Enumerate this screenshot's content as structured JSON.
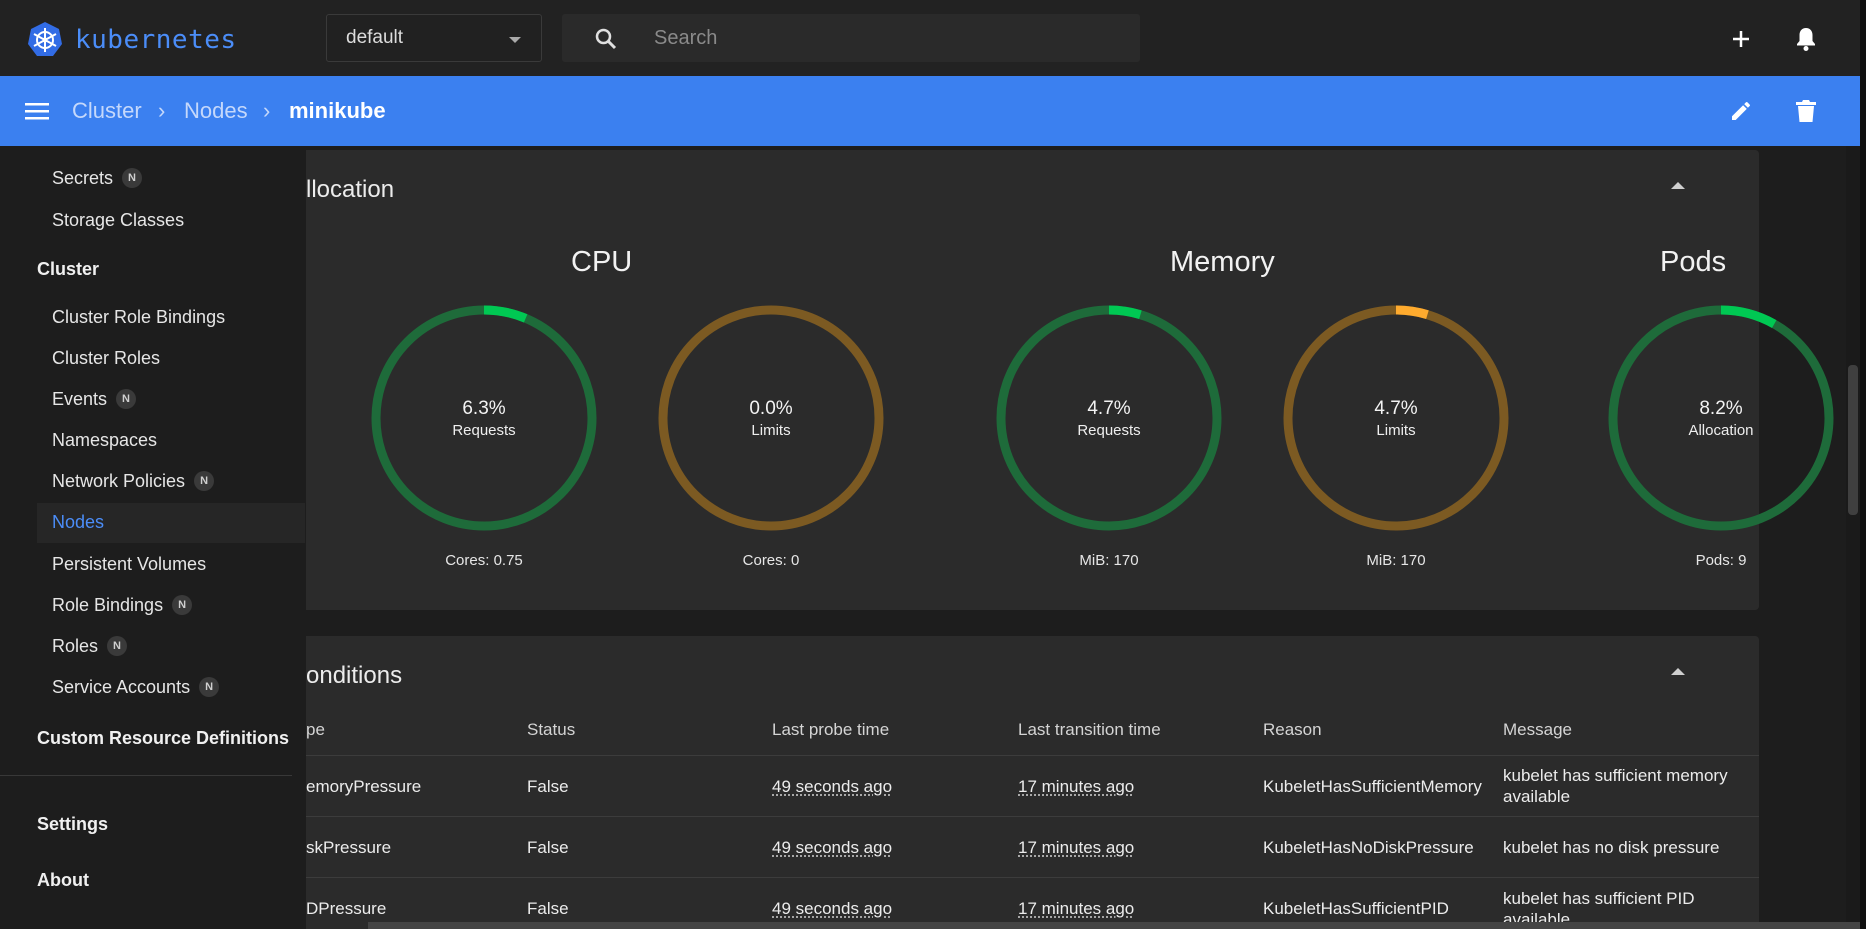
{
  "app": {
    "logo_text": "kubernetes"
  },
  "header": {
    "namespace": "default",
    "search_placeholder": "Search"
  },
  "breadcrumb": {
    "cluster": "Cluster",
    "nodes": "Nodes",
    "current": "minikube"
  },
  "sidebar": {
    "items_top": [
      {
        "label": "Secrets",
        "badge": "N"
      },
      {
        "label": "Storage Classes",
        "badge": ""
      }
    ],
    "cluster_group": "Cluster",
    "cluster_items": [
      {
        "label": "Cluster Role Bindings",
        "badge": ""
      },
      {
        "label": "Cluster Roles",
        "badge": ""
      },
      {
        "label": "Events",
        "badge": "N"
      },
      {
        "label": "Namespaces",
        "badge": ""
      },
      {
        "label": "Network Policies",
        "badge": "N"
      },
      {
        "label": "Nodes",
        "badge": ""
      },
      {
        "label": "Persistent Volumes",
        "badge": ""
      },
      {
        "label": "Role Bindings",
        "badge": "N"
      },
      {
        "label": "Roles",
        "badge": "N"
      },
      {
        "label": "Service Accounts",
        "badge": "N"
      }
    ],
    "crd": "Custom Resource Definitions",
    "settings": "Settings",
    "about": "About"
  },
  "allocation": {
    "title": "llocation",
    "groups": {
      "cpu": "CPU",
      "memory": "Memory",
      "pods": "Pods"
    },
    "gauges": [
      {
        "pct": "6.3%",
        "label": "Requests",
        "foot": "Cores: 0.75",
        "value": 6.3,
        "kind": "ok"
      },
      {
        "pct": "0.0%",
        "label": "Limits",
        "foot": "Cores: 0",
        "value": 0.0,
        "kind": "warn"
      },
      {
        "pct": "4.7%",
        "label": "Requests",
        "foot": "MiB: 170",
        "value": 4.7,
        "kind": "ok"
      },
      {
        "pct": "4.7%",
        "label": "Limits",
        "foot": "MiB: 170",
        "value": 4.7,
        "kind": "warn"
      },
      {
        "pct": "8.2%",
        "label": "Allocation",
        "foot": "Pods: 9",
        "value": 8.2,
        "kind": "ok"
      }
    ]
  },
  "conditions": {
    "title": "onditions",
    "headers": [
      "pe",
      "Status",
      "Last probe time",
      "Last transition time",
      "Reason",
      "Message"
    ],
    "rows": [
      {
        "type": "emoryPressure",
        "status": "False",
        "probe": "49 seconds ago",
        "transition": "17 minutes ago",
        "reason": "KubeletHasSufficientMemory",
        "msg1": "kubelet has sufficient memory",
        "msg2": "available"
      },
      {
        "type": "skPressure",
        "status": "False",
        "probe": "49 seconds ago",
        "transition": "17 minutes ago",
        "reason": "KubeletHasNoDiskPressure",
        "msg1": "kubelet has no disk pressure",
        "msg2": ""
      },
      {
        "type": "DPressure",
        "status": "False",
        "probe": "49 seconds ago",
        "transition": "17 minutes ago",
        "reason": "KubeletHasSufficientPID",
        "msg1": "kubelet has sufficient PID",
        "msg2": "available"
      }
    ]
  },
  "colors": {
    "accent": "#3b80f0",
    "ok_track": "#1e6b3a",
    "ok_fill": "#00c853",
    "warn_track": "#7c5a22",
    "warn_fill": "#ffab2e"
  }
}
